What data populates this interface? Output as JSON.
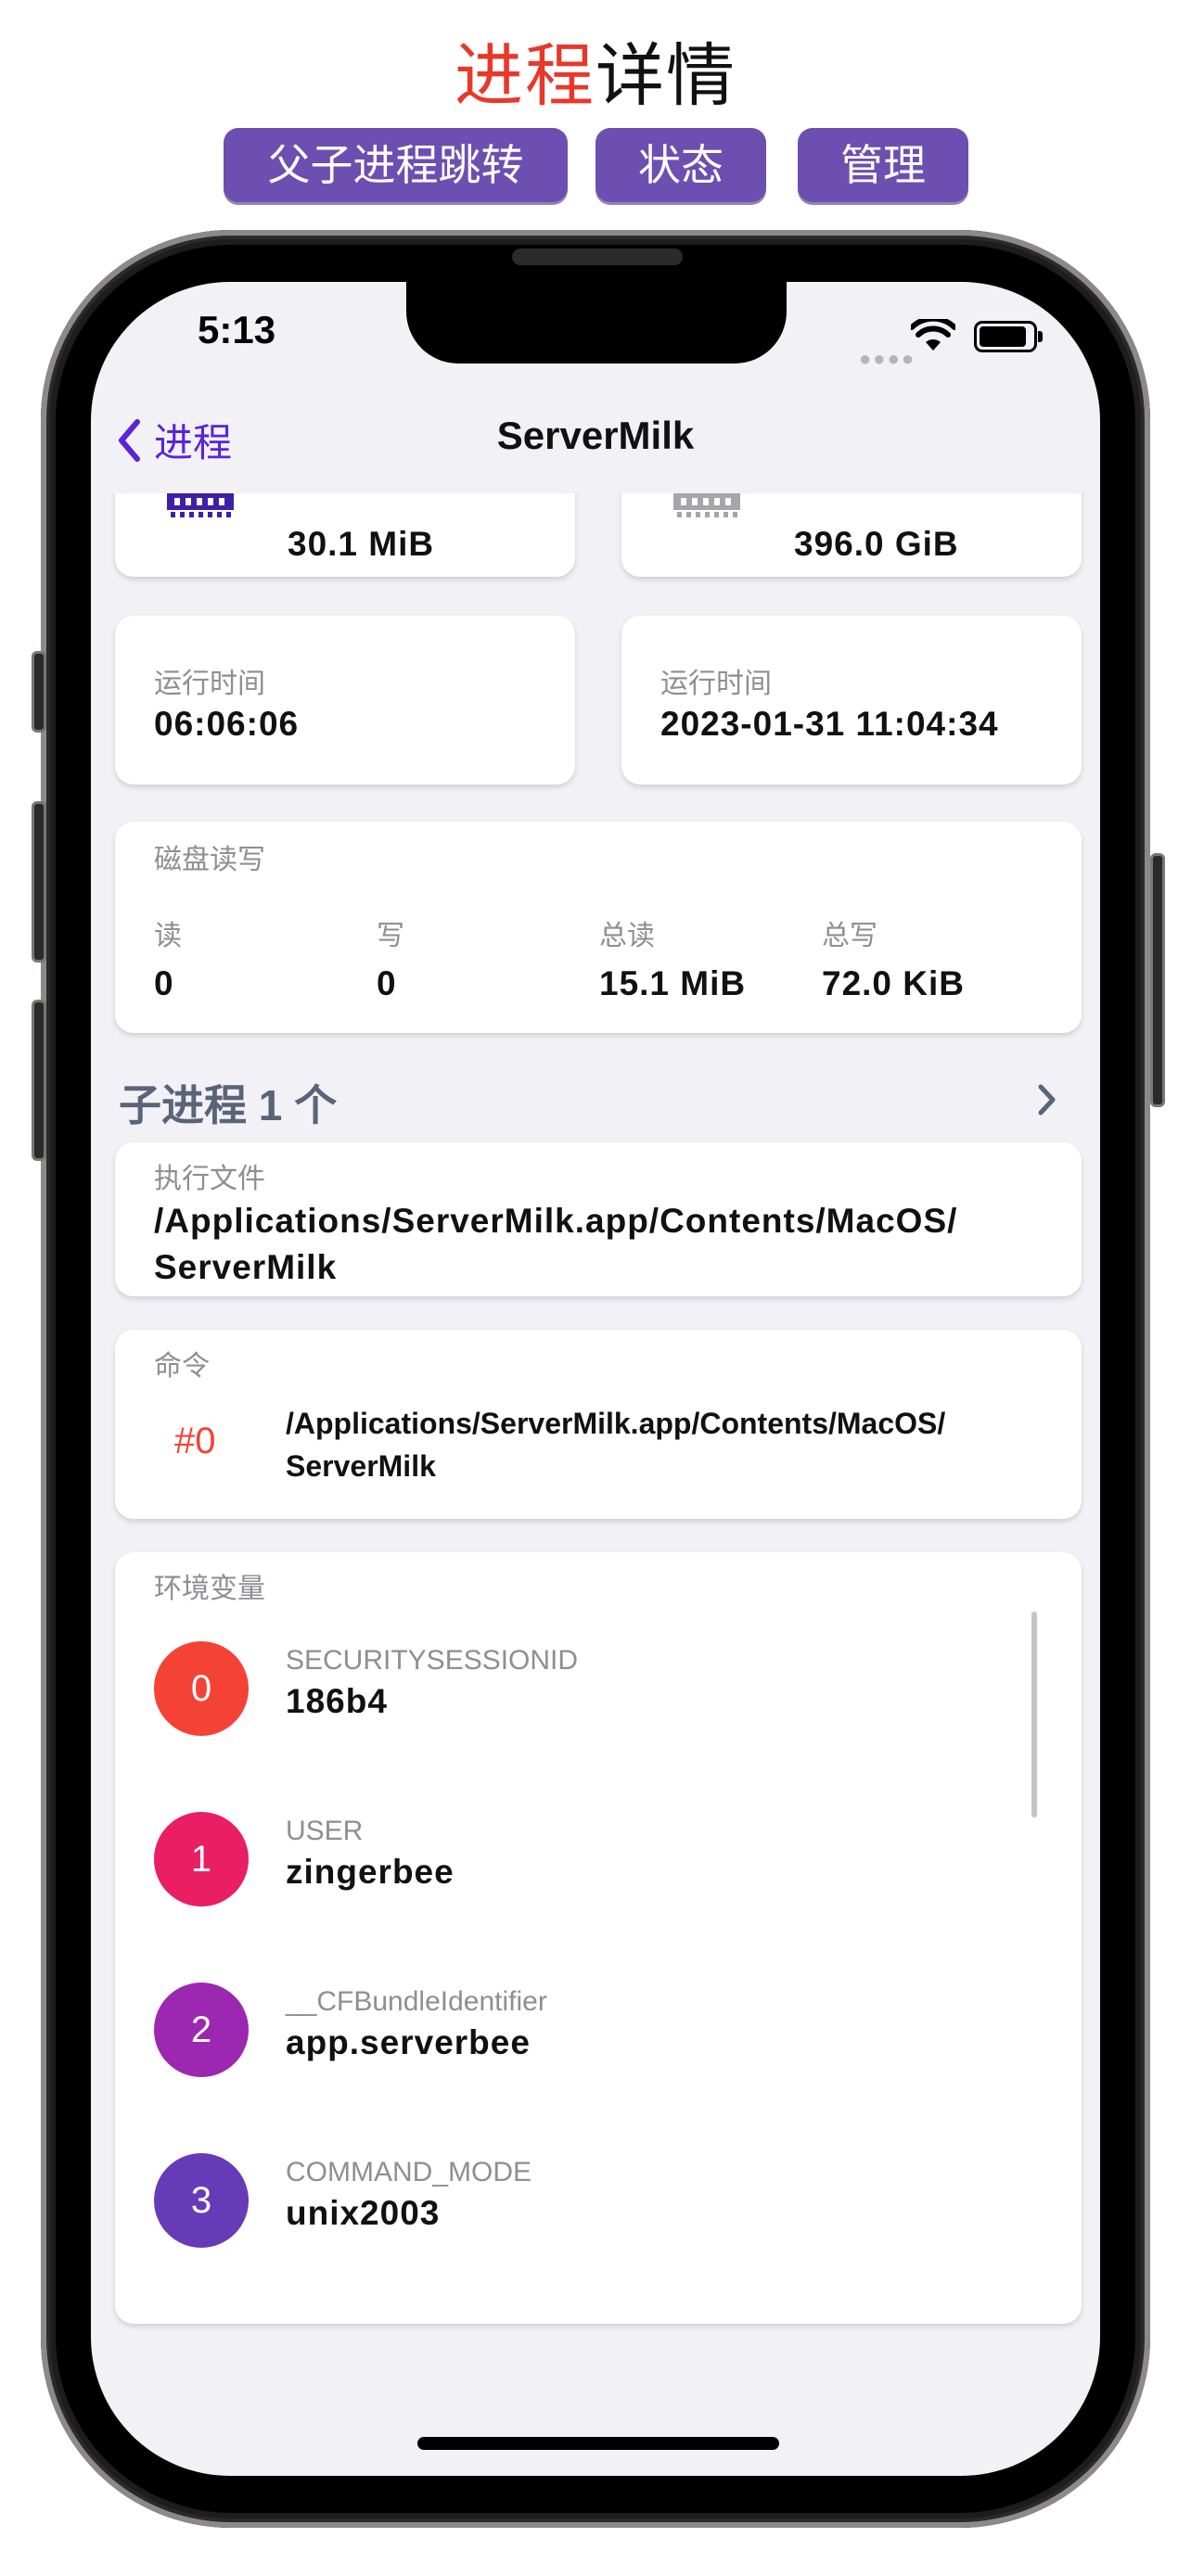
{
  "promo": {
    "title_accent": "进程",
    "title_rest": "详情",
    "tags": [
      "父子进程跳转",
      "状态",
      "管理"
    ],
    "tag_color": "#6c4fb0",
    "accent_color": "#e8382b"
  },
  "status_bar": {
    "time": "5:13"
  },
  "nav": {
    "back_label": "进程",
    "title": "ServerMilk",
    "accent_color": "#5b24d8"
  },
  "memory": {
    "left_value": "30.1 MiB",
    "right_value": "396.0 GiB"
  },
  "runtime": {
    "left_label": "运行时间",
    "left_value": "06:06:06",
    "right_label": "运行时间",
    "right_value": "2023-01-31 11:04:34"
  },
  "disk_io": {
    "title": "磁盘读写",
    "columns": [
      {
        "label": "读",
        "value": "0"
      },
      {
        "label": "写",
        "value": "0"
      },
      {
        "label": "总读",
        "value": "15.1 MiB"
      },
      {
        "label": "总写",
        "value": "72.0 KiB"
      }
    ]
  },
  "children": {
    "title": "子进程 1 个"
  },
  "executable": {
    "label": "执行文件",
    "path_line1": "/Applications/ServerMilk.app/Contents/MacOS/",
    "path_line2": "ServerMilk"
  },
  "command": {
    "label": "命令",
    "arg_index": "#0",
    "arg_line1": "/Applications/ServerMilk.app/Contents/MacOS/",
    "arg_line2": "ServerMilk"
  },
  "env": {
    "title": "环境变量",
    "items": [
      {
        "index": "0",
        "key": "SECURITYSESSIONID",
        "value": "186b4",
        "color": "#f44336"
      },
      {
        "index": "1",
        "key": "USER",
        "value": "zingerbee",
        "color": "#e91e63"
      },
      {
        "index": "2",
        "key": "__CFBundleIdentifier",
        "value": "app.serverbee",
        "color": "#9c27b0"
      },
      {
        "index": "3",
        "key": "COMMAND_MODE",
        "value": "unix2003",
        "color": "#673ab7"
      }
    ]
  }
}
